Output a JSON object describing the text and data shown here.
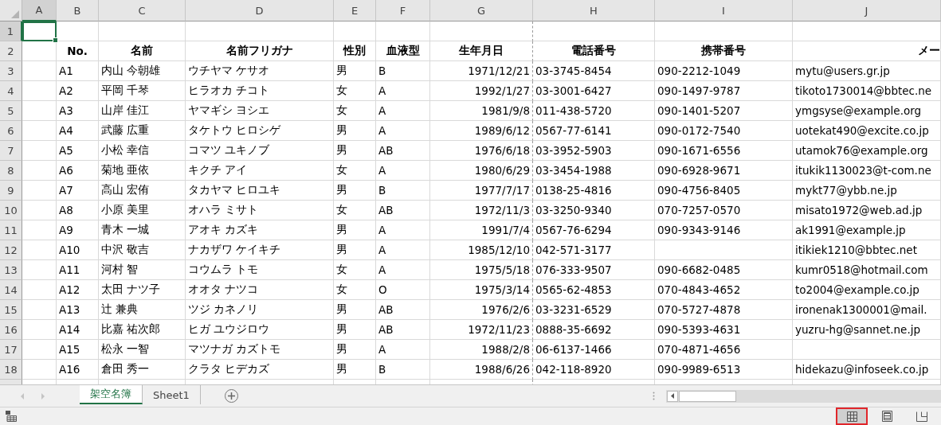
{
  "columns": [
    {
      "label": "A",
      "selected": true,
      "page_break": false
    },
    {
      "label": "B",
      "selected": false,
      "page_break": false
    },
    {
      "label": "C",
      "selected": false,
      "page_break": false
    },
    {
      "label": "D",
      "selected": false,
      "page_break": false
    },
    {
      "label": "E",
      "selected": false,
      "page_break": false
    },
    {
      "label": "F",
      "selected": false,
      "page_break": false
    },
    {
      "label": "G",
      "selected": false,
      "page_break": true
    },
    {
      "label": "H",
      "selected": false,
      "page_break": false
    },
    {
      "label": "I",
      "selected": false,
      "page_break": false
    },
    {
      "label": "J",
      "selected": false,
      "page_break": false
    }
  ],
  "rows": [
    {
      "number": "1",
      "selected": true,
      "kind": "blank",
      "cells": {}
    },
    {
      "number": "2",
      "selected": false,
      "kind": "header",
      "cells": {
        "B": "No.",
        "C": "名前",
        "D": "名前フリガナ",
        "E": "性別",
        "F": "血液型",
        "G": "生年月日",
        "H": "電話番号",
        "I": "携帯番号",
        "J": "メー"
      }
    },
    {
      "number": "3",
      "selected": false,
      "kind": "data",
      "cells": {
        "B": "A1",
        "C": "内山 今朝雄",
        "D": "ウチヤマ ケサオ",
        "E": "男",
        "F": "B",
        "G": "1971/12/21",
        "H": "03-3745-8454",
        "I": "090-2212-1049",
        "J": "mytu@users.gr.jp"
      }
    },
    {
      "number": "4",
      "selected": false,
      "kind": "data",
      "cells": {
        "B": "A2",
        "C": "平岡 千琴",
        "D": "ヒラオカ チコト",
        "E": "女",
        "F": "A",
        "G": "1992/1/27",
        "H": "03-3001-6427",
        "I": "090-1497-9787",
        "J": "tikoto1730014@bbtec.ne"
      }
    },
    {
      "number": "5",
      "selected": false,
      "kind": "data",
      "cells": {
        "B": "A3",
        "C": "山岸 佳江",
        "D": "ヤマギシ ヨシエ",
        "E": "女",
        "F": "A",
        "G": "1981/9/8",
        "H": "011-438-5720",
        "I": "090-1401-5207",
        "J": "ymgsyse@example.org"
      }
    },
    {
      "number": "6",
      "selected": false,
      "kind": "data",
      "cells": {
        "B": "A4",
        "C": "武藤 広重",
        "D": "タケトウ ヒロシゲ",
        "E": "男",
        "F": "A",
        "G": "1989/6/12",
        "H": "0567-77-6141",
        "I": "090-0172-7540",
        "J": "uotekat490@excite.co.jp"
      }
    },
    {
      "number": "7",
      "selected": false,
      "kind": "data",
      "cells": {
        "B": "A5",
        "C": "小松 幸信",
        "D": "コマツ ユキノブ",
        "E": "男",
        "F": "AB",
        "G": "1976/6/18",
        "H": "03-3952-5903",
        "I": "090-1671-6556",
        "J": "utamok76@example.org"
      }
    },
    {
      "number": "8",
      "selected": false,
      "kind": "data",
      "cells": {
        "B": "A6",
        "C": "菊地 亜依",
        "D": "キクチ アイ",
        "E": "女",
        "F": "A",
        "G": "1980/6/29",
        "H": "03-3454-1988",
        "I": "090-6928-9671",
        "J": "itukik1130023@t-com.ne"
      }
    },
    {
      "number": "9",
      "selected": false,
      "kind": "data",
      "cells": {
        "B": "A7",
        "C": "高山 宏侑",
        "D": "タカヤマ ヒロユキ",
        "E": "男",
        "F": "B",
        "G": "1977/7/17",
        "H": "0138-25-4816",
        "I": "090-4756-8405",
        "J": "mykt77@ybb.ne.jp"
      }
    },
    {
      "number": "10",
      "selected": false,
      "kind": "data",
      "cells": {
        "B": "A8",
        "C": "小原 美里",
        "D": "オハラ ミサト",
        "E": "女",
        "F": "AB",
        "G": "1972/11/3",
        "H": "03-3250-9340",
        "I": "070-7257-0570",
        "J": "misato1972@web.ad.jp"
      }
    },
    {
      "number": "11",
      "selected": false,
      "kind": "data",
      "cells": {
        "B": "A9",
        "C": "青木 一城",
        "D": "アオキ カズキ",
        "E": "男",
        "F": "A",
        "G": "1991/7/4",
        "H": "0567-76-6294",
        "I": "090-9343-9146",
        "J": "ak1991@example.jp"
      }
    },
    {
      "number": "12",
      "selected": false,
      "kind": "data",
      "cells": {
        "B": "A10",
        "C": "中沢 敬吉",
        "D": "ナカザワ ケイキチ",
        "E": "男",
        "F": "A",
        "G": "1985/12/10",
        "H": "042-571-3177",
        "J": "itikiek1210@bbtec.net"
      }
    },
    {
      "number": "13",
      "selected": false,
      "kind": "data",
      "cells": {
        "B": "A11",
        "C": "河村 智",
        "D": "コウムラ トモ",
        "E": "女",
        "F": "A",
        "G": "1975/5/18",
        "H": "076-333-9507",
        "I": "090-6682-0485",
        "J": "kumr0518@hotmail.com"
      }
    },
    {
      "number": "14",
      "selected": false,
      "kind": "data",
      "cells": {
        "B": "A12",
        "C": "太田 ナツ子",
        "D": "オオタ ナツコ",
        "E": "女",
        "F": "O",
        "G": "1975/3/14",
        "H": "0565-62-4853",
        "I": "070-4843-4652",
        "J": "to2004@example.co.jp"
      }
    },
    {
      "number": "15",
      "selected": false,
      "kind": "data",
      "cells": {
        "B": "A13",
        "C": "辻 兼典",
        "D": "ツジ カネノリ",
        "E": "男",
        "F": "AB",
        "G": "1976/2/6",
        "H": "03-3231-6529",
        "I": "070-5727-4878",
        "J": "ironenak1300001@mail."
      }
    },
    {
      "number": "16",
      "selected": false,
      "kind": "data",
      "cells": {
        "B": "A14",
        "C": "比嘉 祐次郎",
        "D": "ヒガ ユウジロウ",
        "E": "男",
        "F": "AB",
        "G": "1972/11/23",
        "H": "0888-35-6692",
        "I": "090-5393-4631",
        "J": "yuzru-hg@sannet.ne.jp"
      }
    },
    {
      "number": "17",
      "selected": false,
      "kind": "data",
      "cells": {
        "B": "A15",
        "C": "松永 一智",
        "D": "マツナガ カズトモ",
        "E": "男",
        "F": "A",
        "G": "1988/2/8",
        "H": "06-6137-1466",
        "I": "070-4871-4656"
      }
    },
    {
      "number": "18",
      "selected": false,
      "kind": "data",
      "cells": {
        "B": "A16",
        "C": "倉田 秀一",
        "D": "クラタ ヒデカズ",
        "E": "男",
        "F": "B",
        "G": "1988/6/26",
        "H": "042-118-8920",
        "I": "090-9989-6513",
        "J": "hidekazu@infoseek.co.jp"
      }
    }
  ],
  "sheet_tabs": [
    {
      "label": "架空名簿",
      "selected": true
    },
    {
      "label": "Sheet1",
      "selected": false
    }
  ],
  "views": [
    {
      "kind": "normal",
      "selected": true,
      "highlighted": true
    },
    {
      "kind": "page_layout",
      "selected": false,
      "highlighted": false
    },
    {
      "kind": "page_break",
      "selected": false,
      "highlighted": false
    }
  ]
}
